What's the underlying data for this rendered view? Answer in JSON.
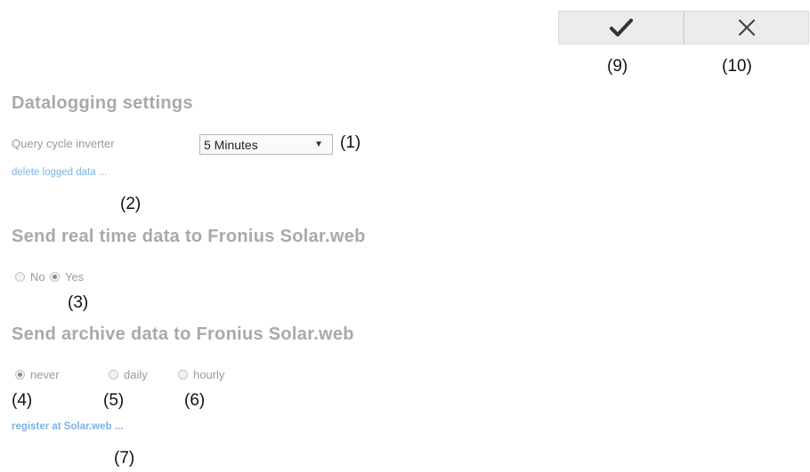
{
  "toolbar": {
    "confirm_icon": "check-icon",
    "cancel_icon": "close-icon",
    "confirm_callout": "(9)",
    "cancel_callout": "(10)"
  },
  "datalogging": {
    "heading": "Datalogging settings",
    "query_label": "Query cycle inverter",
    "query_value": "5 Minutes",
    "query_callout": "(1)",
    "delete_link": "delete logged data ...",
    "delete_callout": "(2)"
  },
  "realtime": {
    "heading": "Send real time data to Fronius Solar.web",
    "options": [
      {
        "label": "No",
        "selected": false
      },
      {
        "label": "Yes",
        "selected": true
      }
    ],
    "callout": "(3)"
  },
  "archive": {
    "heading": "Send archive data to Fronius Solar.web",
    "options": [
      {
        "label": "never",
        "selected": true,
        "callout": "(4)"
      },
      {
        "label": "daily",
        "selected": false,
        "callout": "(5)"
      },
      {
        "label": "hourly",
        "selected": false,
        "callout": "(6)"
      }
    ],
    "register_link": "register at Solar.web ...",
    "register_callout": "(7)"
  }
}
